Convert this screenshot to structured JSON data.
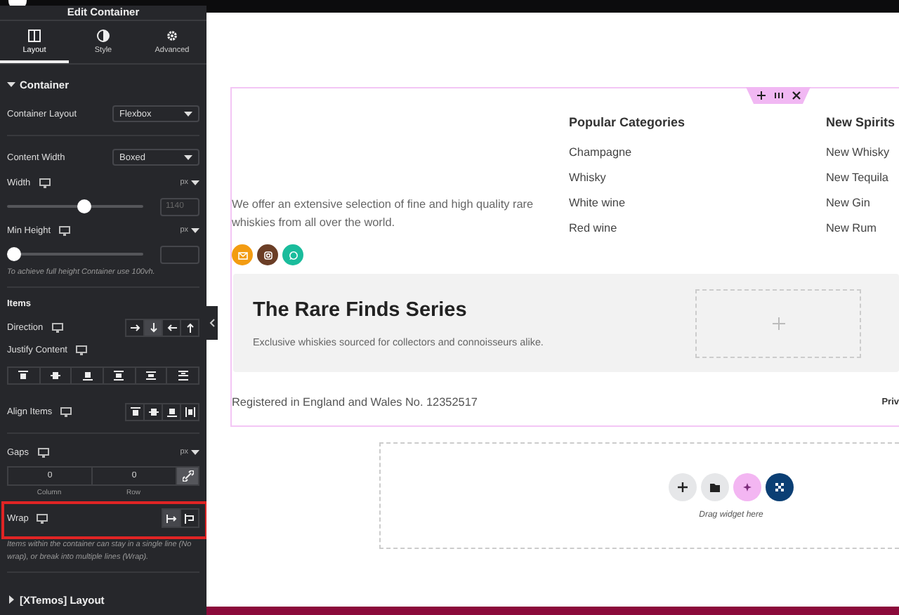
{
  "panel": {
    "title": "Edit Container",
    "tabs": [
      {
        "label": "Layout",
        "kind": "columns",
        "selected": true
      },
      {
        "label": "Style",
        "kind": "contrast",
        "selected": false
      },
      {
        "label": "Advanced",
        "kind": "gear",
        "selected": false
      }
    ],
    "container_section": {
      "title": "Container",
      "expanded": true
    },
    "container_layout": {
      "label": "Container Layout",
      "value": "Flexbox"
    },
    "content_width": {
      "label": "Content Width",
      "value": "Boxed"
    },
    "width": {
      "label": "Width",
      "unit": "px",
      "level": 0.58,
      "placeholder": "1140"
    },
    "min_height": {
      "label": "Min Height",
      "unit": "px",
      "level": 0
    },
    "min_height_note": "To achieve full height Container use 100vh.",
    "items_heading": "Items",
    "direction": {
      "label": "Direction",
      "options": [
        {
          "kind": "right",
          "selected": false
        },
        {
          "kind": "down",
          "selected": true
        },
        {
          "kind": "left",
          "selected": false
        },
        {
          "kind": "up",
          "selected": false
        }
      ]
    },
    "justify_content": {
      "label": "Justify Content",
      "options": [
        {
          "kind": "start",
          "selected": false
        },
        {
          "kind": "center",
          "selected": false
        },
        {
          "kind": "end",
          "selected": false
        },
        {
          "kind": "between",
          "selected": false
        },
        {
          "kind": "around",
          "selected": false
        },
        {
          "kind": "evenly",
          "selected": false
        }
      ]
    },
    "align_items": {
      "label": "Align Items",
      "options": [
        {
          "kind": "start",
          "selected": false
        },
        {
          "kind": "center",
          "selected": false
        },
        {
          "kind": "end",
          "selected": false
        },
        {
          "kind": "stretch",
          "selected": false
        }
      ]
    },
    "gaps": {
      "label": "Gaps",
      "unit": "px",
      "column": {
        "value": "0",
        "label": "Column"
      },
      "row": {
        "value": "0",
        "label": "Row"
      },
      "linked": true
    },
    "wrap": {
      "label": "Wrap",
      "highlighted": true,
      "options": [
        {
          "kind": "nowrap",
          "selected": true
        },
        {
          "kind": "wrap",
          "selected": false
        }
      ],
      "note": "Items within the container can stay in a single line (No wrap), or break into multiple lines (Wrap)."
    },
    "next_section": {
      "title": "[XTemos] Layout",
      "expanded": false
    }
  },
  "canvas": {
    "footer": {
      "about": "We offer an extensive selection of fine and high quality rare whiskies from all over the world.",
      "social": [
        {
          "kind": "email",
          "color": "#f39c12"
        },
        {
          "kind": "instagram",
          "color": "#6b3e26"
        },
        {
          "kind": "whatsapp",
          "color": "#1abc9c"
        }
      ],
      "columns": [
        {
          "heading": "Popular Categories",
          "links": [
            "Champagne",
            "Whisky",
            "White wine",
            "Red wine"
          ]
        },
        {
          "heading": "New Spirits",
          "links": [
            "New Whisky",
            "New Tequila",
            "New Gin",
            "New Rum"
          ]
        }
      ],
      "banner": {
        "title": "The Rare Finds Series",
        "subtitle": "Exclusive whiskies sourced for collectors and connoisseurs alike."
      },
      "registration": "Registered in England and Wales No. 12352517",
      "bottom_link": "Priv"
    },
    "drop_zone": {
      "hint": "Drag widget here"
    }
  }
}
